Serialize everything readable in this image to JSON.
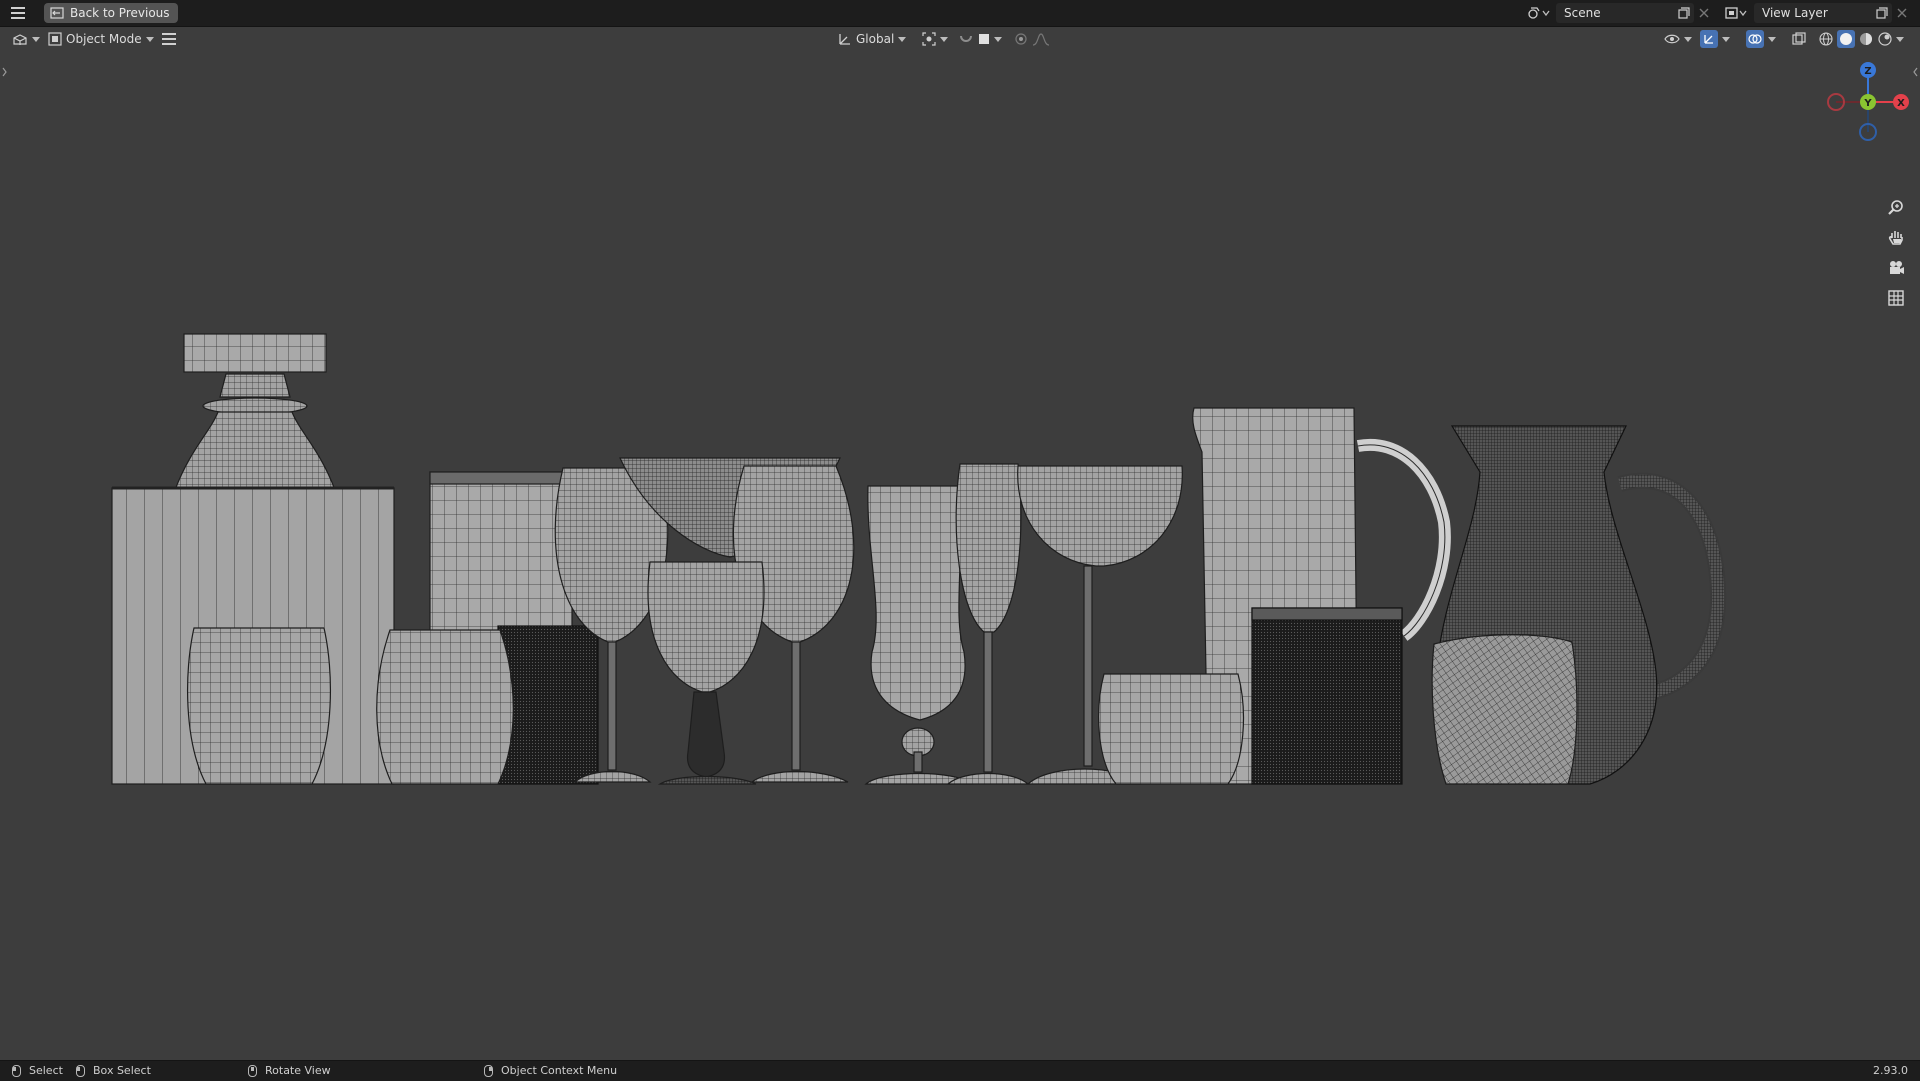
{
  "topbar": {
    "back_label": "Back to Previous",
    "scene_label": "Scene",
    "view_layer_label": "View Layer"
  },
  "viewport_header": {
    "mode_label": "Object Mode",
    "orientation_label": "Global"
  },
  "statusbar": {
    "items": [
      {
        "label": "Select"
      },
      {
        "label": "Box Select"
      },
      {
        "label": "Rotate View"
      },
      {
        "label": "Object Context Menu"
      }
    ],
    "version": "2.93.0"
  },
  "gizmo": {
    "axes": [
      "Z",
      "Y",
      "X"
    ],
    "colors": {
      "x": "#e4414b",
      "y": "#8ac431",
      "z": "#3978d8"
    }
  },
  "icons": [
    "menu-icon",
    "back-icon",
    "scene-icon",
    "view-layer-icon",
    "zoom-icon",
    "hand-icon",
    "camera-icon",
    "grid-icon"
  ]
}
